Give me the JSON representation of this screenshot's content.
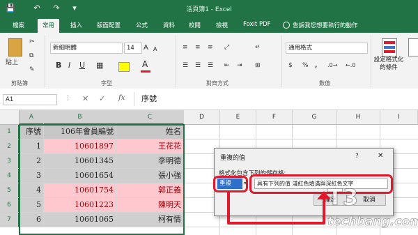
{
  "window": {
    "title": "活頁簿1 - Excel"
  },
  "quick_access": {
    "save": "💾",
    "undo": "↶",
    "redo": "↷",
    "more": "▾"
  },
  "tabs": [
    "檔案",
    "常用",
    "插入",
    "版面配置",
    "公式",
    "資料",
    "校閱",
    "檢視",
    "Foxit PDF"
  ],
  "tell_me": "告訴我您想要執行的動作",
  "ribbon": {
    "paste_label": "貼上",
    "clipboard_group": "剪貼簿",
    "font_name": "新細明體",
    "font_size": "14",
    "font_group": "字型",
    "alignment_group": "對齊方式",
    "number_format": "通用格式",
    "number_group": "數值",
    "conditional_format_label": "設定格式化的條件",
    "bold": "B",
    "italic": "I",
    "underline": "U",
    "font_color_glyph": "A",
    "grow_font": "A",
    "shrink_font": "A",
    "currency": "$",
    "percent": "%",
    "comma": ","
  },
  "formula_bar": {
    "name_box": "A1",
    "cancel": "✕",
    "confirm": "✓",
    "fx": "fx",
    "content": "序號"
  },
  "columns": [
    "A",
    "B",
    "C",
    "D",
    "E",
    "F",
    "G",
    "H",
    "I"
  ],
  "rows": [
    "1",
    "2",
    "3",
    "4",
    "5",
    "6",
    "7"
  ],
  "table": [
    {
      "a": "序號",
      "b": "106年會員編號",
      "c": "姓名"
    },
    {
      "a": "1",
      "b": "10601897",
      "c": "王花花",
      "dup": true
    },
    {
      "a": "2",
      "b": "10601345",
      "c": "李明德",
      "dup": false
    },
    {
      "a": "3",
      "b": "10601654",
      "c": "張小強",
      "dup": false
    },
    {
      "a": "4",
      "b": "10601754",
      "c": "郭正義",
      "dup": true
    },
    {
      "a": "5",
      "b": "10601223",
      "c": "陳明天",
      "dup": true
    },
    {
      "a": "6",
      "b": "10601065",
      "c": "柯有情",
      "dup": false
    }
  ],
  "dialog": {
    "title": "重複的值",
    "help": "?",
    "close": "✕",
    "prompt": "格式化包含下列的儲存格:",
    "type_value": "重複",
    "format_value": "具有下列的值 淺紅色填滿與深紅色文字",
    "ok": "確定",
    "cancel": "取消"
  },
  "watermark": "techbang.com",
  "colors": {
    "excel_green": "#217346",
    "dup_fill": "#ffc7ce",
    "dup_text": "#9c0006",
    "annotation_red": "#e2192c"
  }
}
